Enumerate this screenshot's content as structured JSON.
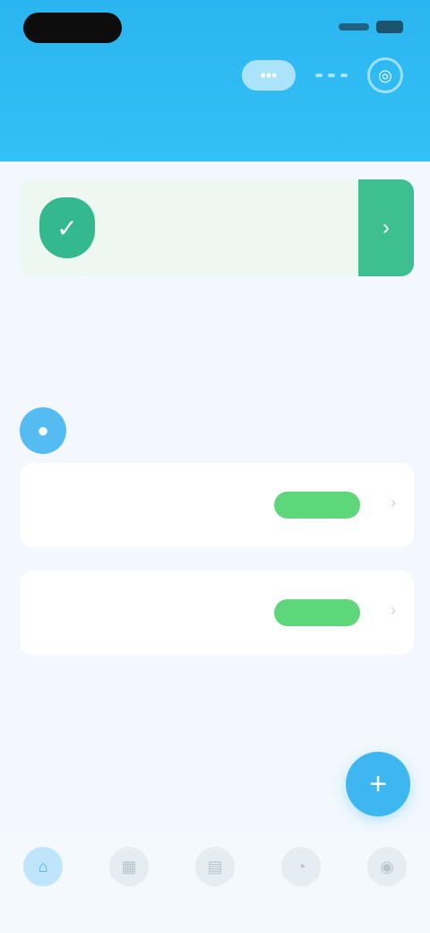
{
  "colors": {
    "header": "#2bb5f0",
    "accent": "#3eb6f0",
    "success": "#5ed67a",
    "banner_button": "#3dbf91",
    "background": "#f2f8fd"
  },
  "status_bar": {
    "time": ""
  },
  "header": {
    "title": "",
    "action_pill_icon": "more-icon",
    "action_circle_icon": "target-icon"
  },
  "banner": {
    "icon": "shield-icon",
    "text": "",
    "button_icon": "chevron-right-icon"
  },
  "info": {
    "left": "",
    "right": ""
  },
  "stats": [
    {
      "value": "",
      "label": ""
    },
    {
      "value": "",
      "label": ""
    }
  ],
  "section": {
    "icon": "user-icon",
    "more": ""
  },
  "cards": [
    {
      "title": "",
      "subtitle": "",
      "status": "",
      "status_color": "#5ed67a"
    },
    {
      "title": "",
      "subtitle": "",
      "status": "",
      "status_color": "#5ed67a"
    }
  ],
  "fab": {
    "icon": "plus-icon"
  },
  "bottom_nav": [
    {
      "icon": "home-icon",
      "label": "",
      "active": true
    },
    {
      "icon": "grid-icon",
      "label": "",
      "active": false
    },
    {
      "icon": "chart-icon",
      "label": "",
      "active": false
    },
    {
      "icon": "bell-icon",
      "label": "",
      "active": false
    },
    {
      "icon": "profile-icon",
      "label": "",
      "active": false
    }
  ]
}
